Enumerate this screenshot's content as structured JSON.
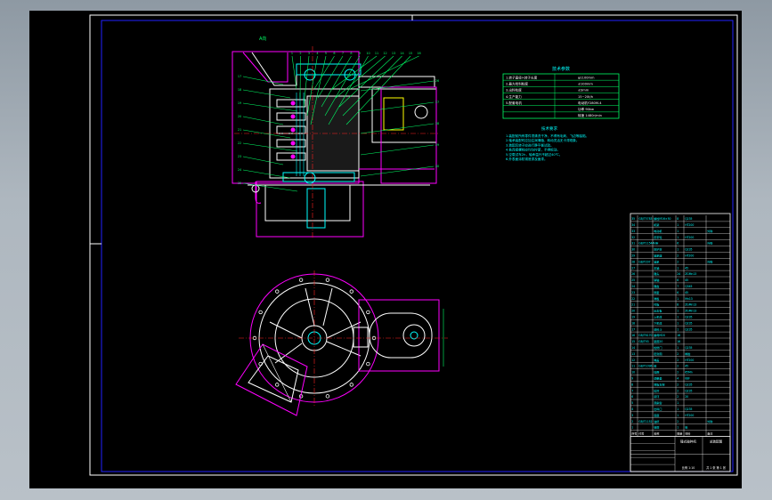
{
  "colors": {
    "canvas": "#000000",
    "frame": "#ffffff",
    "title_border": "#2222ff",
    "cyan": "#00ffff",
    "green": "#00ff66",
    "magenta": "#ff00ff",
    "white": "#ffffff",
    "yellow": "#ffff00",
    "red": "#ff2020"
  },
  "spec_table": {
    "title": "技术参数",
    "rows": [
      {
        "label": "1.转子直径×转子长度",
        "value": "φ1100mm"
      },
      {
        "label": "2.最大给料粒度",
        "value": "≤100mm"
      },
      {
        "label": "3.出料粒度",
        "value": "≤3mm"
      },
      {
        "label": "4.生产能力",
        "value": "15~20t/h"
      },
      {
        "label": "5.配套电机",
        "value": "电动机Y280M-4"
      },
      {
        "label": "",
        "value": "功率 90kw"
      },
      {
        "label": "",
        "value": "转速 1480r/min"
      }
    ]
  },
  "tech_requirements": {
    "title": "技术要求",
    "lines": [
      "1.装配前所有零件须清洗干净，不得有毛刺、飞边等缺陷。",
      "2.轴承装配时应加注润滑脂，转动灵活无卡滞现象。",
      "3.装配后转子应进行静平衡试验。",
      "4.各连接螺栓应均匀拧紧，不得松动。",
      "5.空载试车2h，轴承温升不超过40℃。",
      "6.外表面涂防锈底漆及面漆。"
    ]
  },
  "callouts": {
    "view_mark": "A向",
    "top_numbers": [
      "1",
      "2",
      "3",
      "4",
      "5",
      "6",
      "7",
      "8",
      "9",
      "10",
      "11",
      "12",
      "13",
      "14",
      "15",
      "16"
    ],
    "left_numbers": [
      "17",
      "18",
      "19",
      "20",
      "21",
      "22",
      "23",
      "24",
      "25"
    ],
    "right_numbers": [
      "26",
      "27",
      "28",
      "29",
      "30"
    ]
  },
  "bom": {
    "headers": [
      "序号",
      "代号",
      "名称",
      "数量",
      "材料",
      "备注"
    ],
    "rows": [
      [
        "35",
        "GB/T5783",
        "螺栓M16×50",
        "8",
        "Q235",
        ""
      ],
      [
        "34",
        "",
        "机架",
        "1",
        "HT200",
        ""
      ],
      [
        "33",
        "",
        "电动机",
        "1",
        "",
        "外购"
      ],
      [
        "32",
        "",
        "皮带轮",
        "1",
        "HT200",
        ""
      ],
      [
        "31",
        "GB/T11544",
        "V带",
        "6",
        "",
        "外购"
      ],
      [
        "30",
        "",
        "防护罩",
        "1",
        "Q235",
        ""
      ],
      [
        "29",
        "",
        "轴承座",
        "2",
        "HT200",
        ""
      ],
      [
        "28",
        "GB/T297",
        "轴承",
        "2",
        "",
        "外购"
      ],
      [
        "27",
        "",
        "主轴",
        "1",
        "45",
        ""
      ],
      [
        "26",
        "",
        "锤头",
        "24",
        "ZGMn13",
        ""
      ],
      [
        "25",
        "",
        "销轴",
        "6",
        "45",
        ""
      ],
      [
        "24",
        "",
        "锤盘",
        "7",
        "Q345",
        ""
      ],
      [
        "23",
        "",
        "隔套",
        "6",
        "45",
        ""
      ],
      [
        "22",
        "",
        "筛板",
        "1",
        "Mn13",
        ""
      ],
      [
        "21",
        "",
        "衬板",
        "8",
        "ZGMn13",
        ""
      ],
      [
        "20",
        "",
        "反击板",
        "1",
        "ZGMn13",
        ""
      ],
      [
        "19",
        "",
        "上机体",
        "1",
        "Q235",
        ""
      ],
      [
        "18",
        "",
        "下机体",
        "1",
        "Q235",
        ""
      ],
      [
        "17",
        "",
        "进料斗",
        "1",
        "Q235",
        ""
      ],
      [
        "16",
        "GB/T6170",
        "螺母M20",
        "16",
        "",
        ""
      ],
      [
        "15",
        "GB/T93",
        "垫圈20",
        "16",
        "",
        ""
      ],
      [
        "14",
        "",
        "检修门",
        "1",
        "Q235",
        ""
      ],
      [
        "13",
        "",
        "密封圈",
        "2",
        "橡胶",
        ""
      ],
      [
        "12",
        "",
        "端盖",
        "2",
        "HT200",
        ""
      ],
      [
        "11",
        "GB/T1096",
        "键",
        "2",
        "45",
        ""
      ],
      [
        "10",
        "",
        "挡圈",
        "2",
        "65Mn",
        ""
      ],
      [
        "9",
        "",
        "调整垫",
        "4",
        "08F",
        ""
      ],
      [
        "8",
        "",
        "筛板支架",
        "2",
        "Q235",
        ""
      ],
      [
        "7",
        "",
        "拉杆",
        "2",
        "Q235",
        ""
      ],
      [
        "6",
        "",
        "吊环",
        "2",
        "20",
        ""
      ],
      [
        "5",
        "",
        "观察窗",
        "1",
        "",
        ""
      ],
      [
        "4",
        "",
        "出料口",
        "1",
        "Q235",
        ""
      ],
      [
        "3",
        "",
        "底座",
        "1",
        "HT200",
        ""
      ],
      [
        "2",
        "GB/T1152",
        "油杯",
        "2",
        "",
        "外购"
      ],
      [
        "1",
        "",
        "铭牌",
        "1",
        "铝",
        ""
      ]
    ],
    "footer_texts": [
      "锤式破碎机",
      "总装配图",
      "比例 1:10",
      "共 1 张 第 1 张"
    ]
  }
}
